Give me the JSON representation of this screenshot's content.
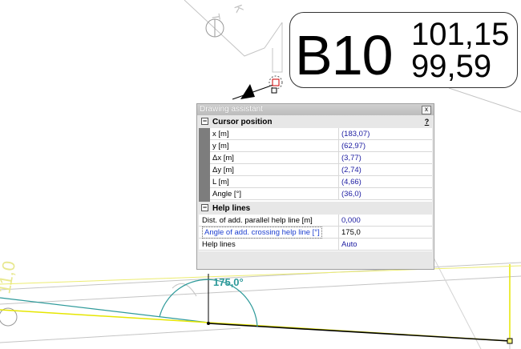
{
  "label": {
    "main": "B10",
    "top_value": "101,15",
    "bottom_value": "99,59"
  },
  "angle_label": "175,0°",
  "dialog": {
    "title": "Drawing assistant",
    "close_glyph": "x",
    "cursor_section": {
      "title": "Cursor position",
      "help": "?",
      "rows": [
        {
          "label": "x [m]",
          "value": "(183,07)"
        },
        {
          "label": "y [m]",
          "value": "(62,97)"
        },
        {
          "label": "Δx [m]",
          "value": "(3,77)"
        },
        {
          "label": "Δy [m]",
          "value": "(2,74)"
        },
        {
          "label": "L [m]",
          "value": "(4,66)"
        },
        {
          "label": "Angle [°]",
          "value": "(36,0)"
        }
      ]
    },
    "help_section": {
      "title": "Help lines",
      "rows": [
        {
          "label": "Dist. of add. parallel help line [m]",
          "value": "0,000"
        },
        {
          "label": "Angle of add. crossing help line [°]",
          "value": "175,0"
        },
        {
          "label": "Help lines",
          "value": "Auto"
        }
      ]
    }
  },
  "colors": {
    "yellow_line": "#e6e600",
    "teal_line": "#2e9a9a",
    "cad_gray": "#b4b4b4",
    "selection_red": "#cc0000"
  }
}
